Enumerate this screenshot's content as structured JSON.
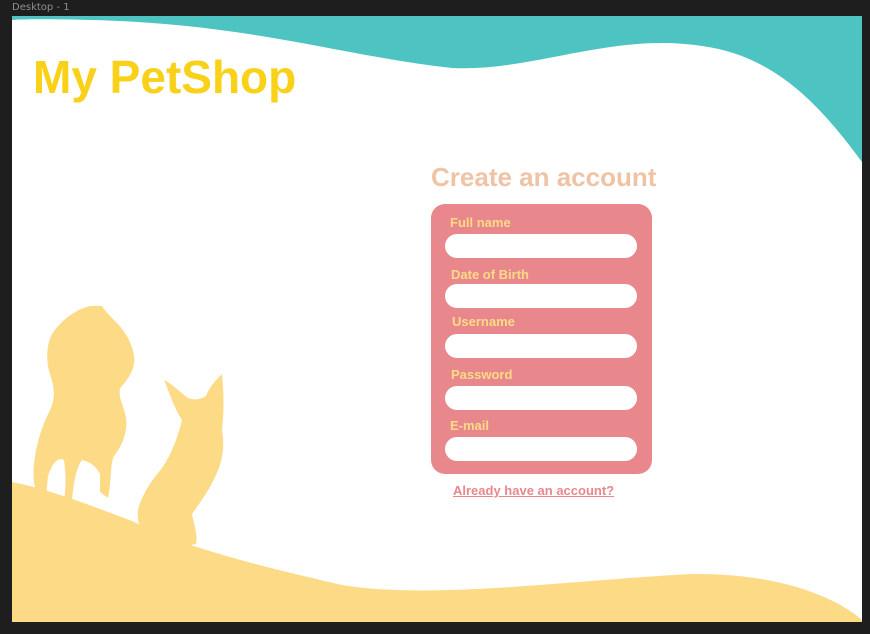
{
  "frame": {
    "label": "Desktop - 1"
  },
  "brand": {
    "title": "My PetShop"
  },
  "form": {
    "title": "Create an account",
    "fields": [
      {
        "label": "Full name",
        "value": "",
        "placeholder": ""
      },
      {
        "label": "Date of Birth",
        "value": "",
        "placeholder": ""
      },
      {
        "label": "Username",
        "value": "",
        "placeholder": ""
      },
      {
        "label": "Password",
        "value": "",
        "placeholder": ""
      },
      {
        "label": "E-mail",
        "value": "",
        "placeholder": ""
      }
    ]
  },
  "links": {
    "sign_in": "Already have an account?"
  },
  "colors": {
    "canvas": "#1e1e1e",
    "background": "#ffffff",
    "teal_wave": "#4dc3c2",
    "sand_wave": "#fddb86",
    "brand": "#f8d118",
    "form_title": "#efc3a5",
    "card": "#e8878c",
    "field_label": "#fddb86",
    "link": "#e8878c"
  },
  "illustration": {
    "icons": [
      "dog-silhouette-icon",
      "cat-silhouette-icon"
    ]
  }
}
